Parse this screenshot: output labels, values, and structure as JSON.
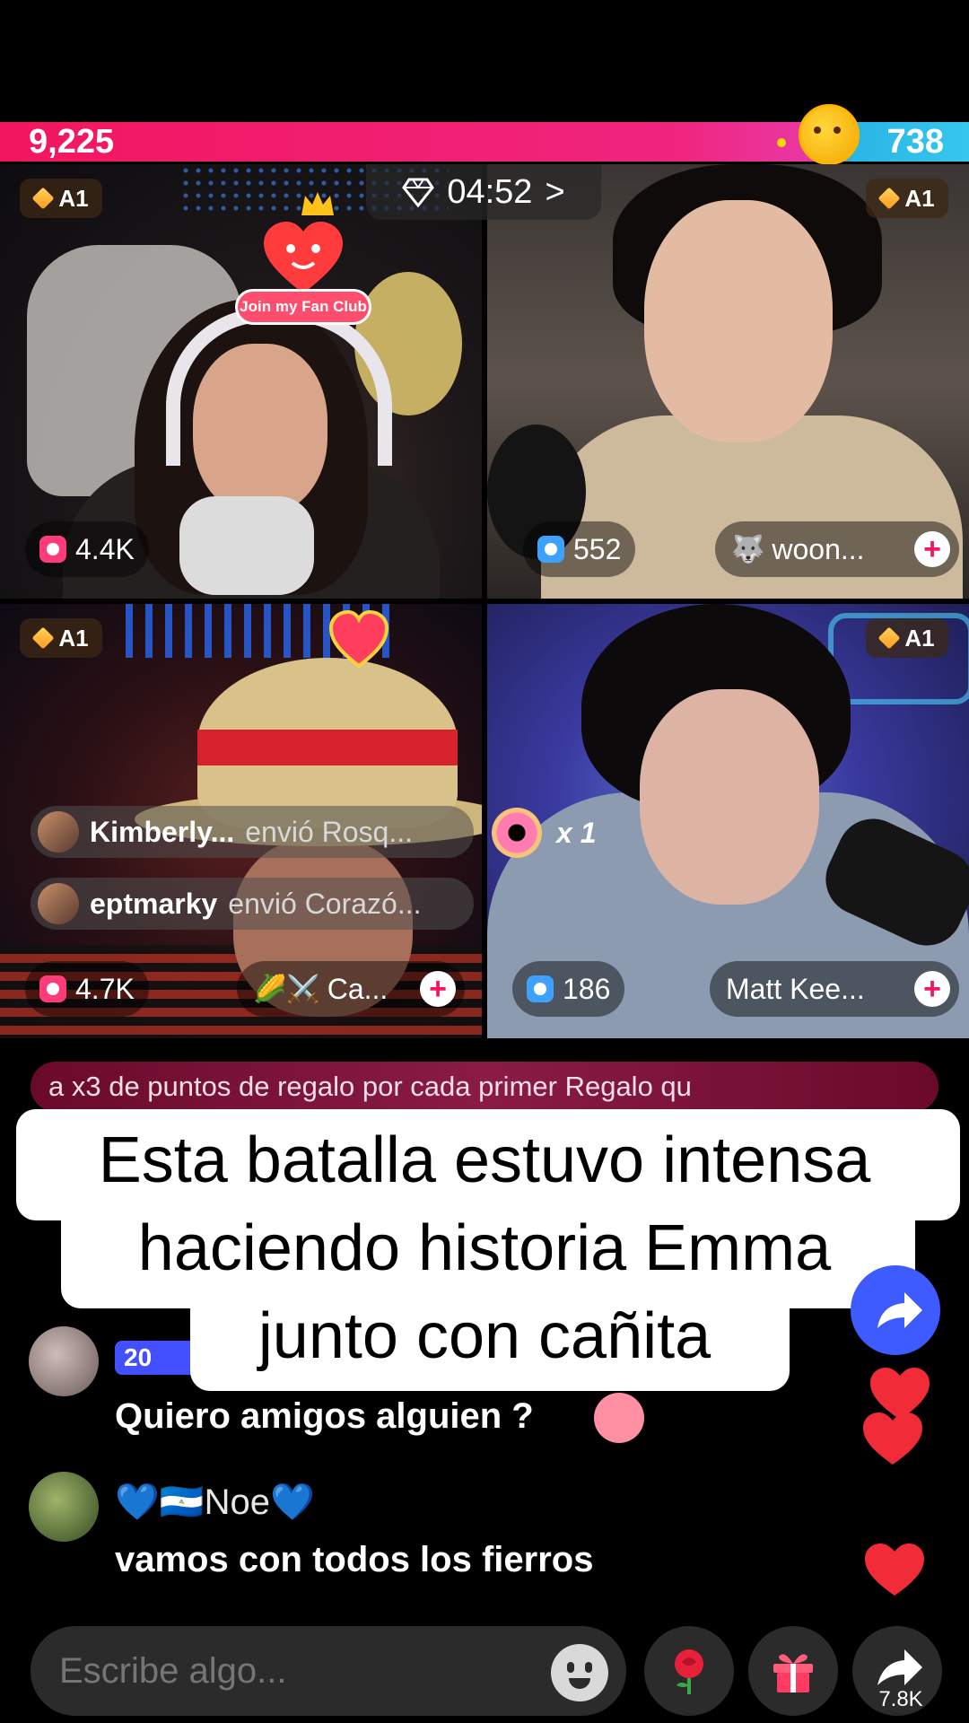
{
  "battle": {
    "score_left": "9,225",
    "score_right": "738",
    "timer": "04:52",
    "timer_chevron": ">",
    "colors": {
      "left": "#f2165f",
      "right": "#36c6ee"
    }
  },
  "tiles": [
    {
      "rank": "A1",
      "viewers": "4.4K",
      "fan_club": "Join my Fan Club"
    },
    {
      "rank": "A1",
      "viewers": "552",
      "host_name": "woon..."
    },
    {
      "rank": "A1",
      "viewers": "4.7K",
      "host_name": "Ca...",
      "host_emoji": "🌽⚔️"
    },
    {
      "rank": "A1",
      "viewers": "186",
      "host_name": "Matt Kee..."
    }
  ],
  "gift_feed": [
    {
      "user": "Kimberly...",
      "action": "envió Rosq..."
    },
    {
      "user": "eptmarky",
      "action": "envió Corazó..."
    }
  ],
  "gift_combo": {
    "count": "x 1"
  },
  "promo_banner": "a x3 de puntos de regalo por cada primer Regalo qu",
  "caption": {
    "line1": "Esta batalla estuvo intensa",
    "line2": "haciendo historia Emma",
    "line3": "junto con cañita"
  },
  "chat": [
    {
      "level": "20",
      "user": "",
      "message": "Quiero amigos alguien ?"
    },
    {
      "user": "💙🇳🇮Noe💙",
      "message": "vamos con todos los fierros"
    }
  ],
  "bottom_bar": {
    "placeholder": "Escribe algo...",
    "share_count": "7.8K"
  }
}
